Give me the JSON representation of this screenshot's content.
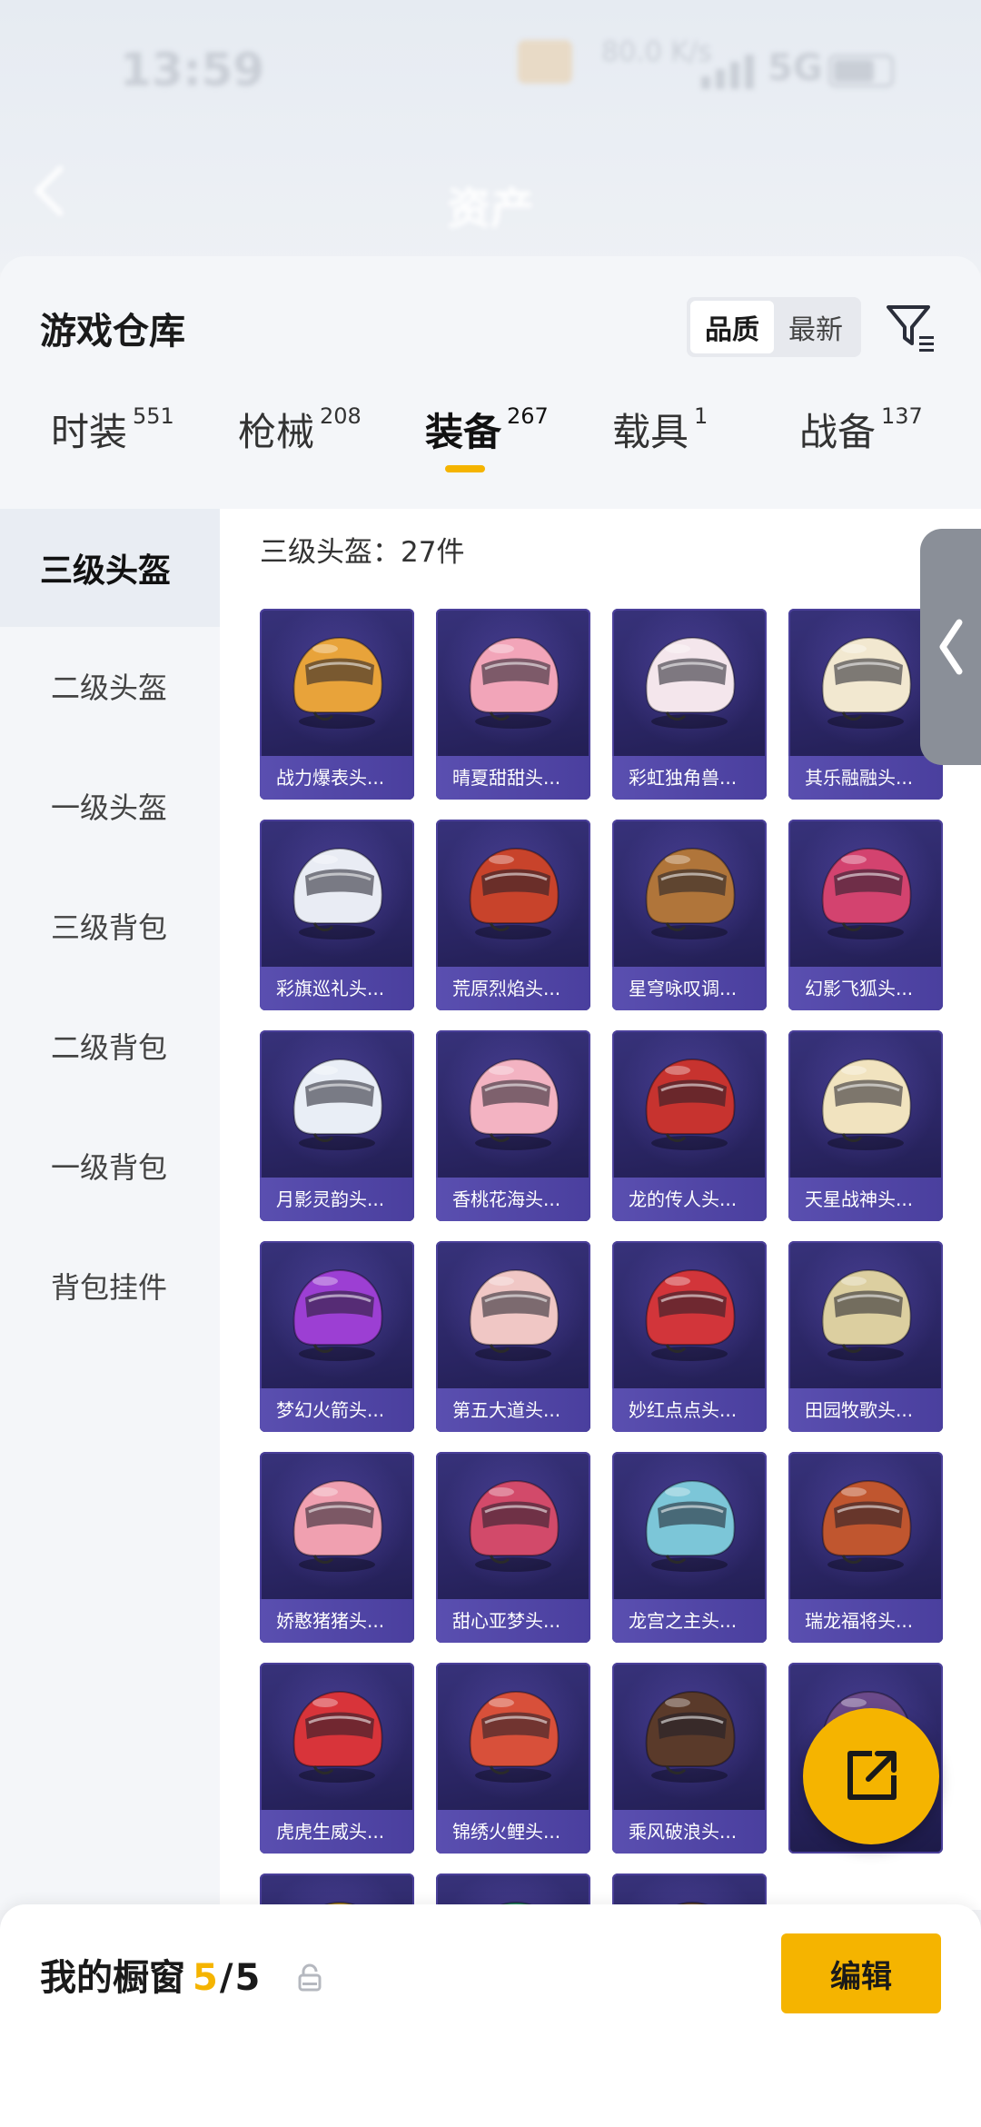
{
  "status_bar": {
    "time": "13:59",
    "network": "5G",
    "speed": "80.0 K/s"
  },
  "nav": {
    "title": "资产"
  },
  "panel": {
    "title": "游戏仓库",
    "sort_options": [
      "品质",
      "最新"
    ],
    "sort_active": "品质",
    "filter_icon": "filter-icon"
  },
  "tabs": [
    {
      "label": "时装",
      "count": "551"
    },
    {
      "label": "枪械",
      "count": "208"
    },
    {
      "label": "装备",
      "count": "267"
    },
    {
      "label": "载具",
      "count": "1"
    },
    {
      "label": "战备",
      "count": "137"
    }
  ],
  "active_tab": "装备",
  "categories": [
    "三级头盔",
    "二级头盔",
    "一级头盔",
    "三级背包",
    "二级背包",
    "一级背包",
    "背包挂件"
  ],
  "active_category": "三级头盔",
  "grid": {
    "count_label": "三级头盔：27件",
    "items": [
      {
        "name": "战力爆表头...",
        "color": "#e8a33a"
      },
      {
        "name": "晴夏甜甜头...",
        "color": "#f2a5b9"
      },
      {
        "name": "彩虹独角兽...",
        "color": "#f4e6ec"
      },
      {
        "name": "其乐融融头...",
        "color": "#f2e8d0"
      },
      {
        "name": "彩旗巡礼头...",
        "color": "#e9ecf4"
      },
      {
        "name": "荒原烈焰头...",
        "color": "#c8432b"
      },
      {
        "name": "星穹咏叹调...",
        "color": "#b0753a"
      },
      {
        "name": "幻影飞狐头...",
        "color": "#d3436f"
      },
      {
        "name": "月影灵韵头...",
        "color": "#e9eef6"
      },
      {
        "name": "香桃花海头...",
        "color": "#f3b3c2"
      },
      {
        "name": "龙的传人头...",
        "color": "#c7332f"
      },
      {
        "name": "天星战神头...",
        "color": "#f1e3bf"
      },
      {
        "name": "梦幻火箭头...",
        "color": "#9c3fd3"
      },
      {
        "name": "第五大道头...",
        "color": "#f0c7c5"
      },
      {
        "name": "妙红点点头...",
        "color": "#d2353a"
      },
      {
        "name": "田园牧歌头...",
        "color": "#dccfa0"
      },
      {
        "name": "娇憨猪猪头...",
        "color": "#f0a0b0"
      },
      {
        "name": "甜心亚梦头...",
        "color": "#d24a6a"
      },
      {
        "name": "龙宫之主头...",
        "color": "#7cc6d8"
      },
      {
        "name": "瑞龙福将头...",
        "color": "#c0562f"
      },
      {
        "name": "虎虎生威头...",
        "color": "#d8343a"
      },
      {
        "name": "锦绣火鲤头...",
        "color": "#d8503a"
      },
      {
        "name": "乘风破浪头...",
        "color": "#5a3a2a"
      },
      {
        "name": "",
        "color": "#6b4a8a"
      },
      {
        "name": "",
        "color": "#b48a2a"
      },
      {
        "name": "",
        "color": "#2a8a6a"
      },
      {
        "name": "",
        "color": "#6a4a3a"
      }
    ]
  },
  "bottom": {
    "label": "我的橱窗",
    "count": "5",
    "total": "5",
    "edit_label": "编辑"
  },
  "colors": {
    "accent": "#f5b400",
    "card_bg": "#2a2563"
  }
}
